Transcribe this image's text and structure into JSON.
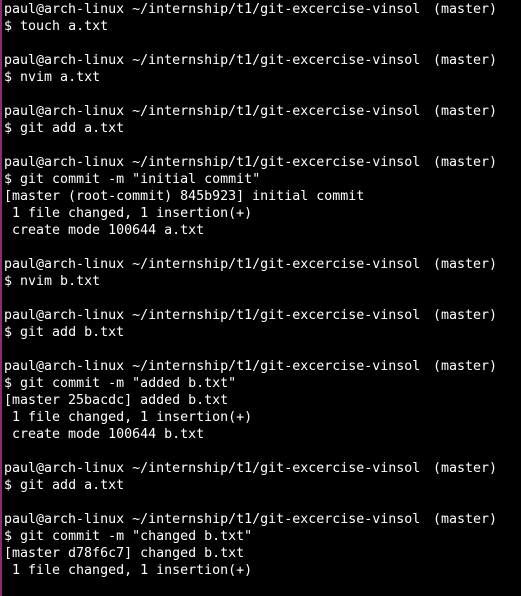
{
  "terminal": {
    "prompt": {
      "user_host_path": "paul@arch-linux ~/internship/t1/git-excercise-vinsol",
      "branch": "(master)",
      "symbol": "$"
    },
    "blocks": [
      {
        "command": "touch a.txt",
        "output": []
      },
      {
        "command": "nvim a.txt",
        "output": []
      },
      {
        "command": "git add a.txt",
        "output": []
      },
      {
        "command": "git commit -m \"initial commit\"",
        "output": [
          "[master (root-commit) 845b923] initial commit",
          " 1 file changed, 1 insertion(+)",
          " create mode 100644 a.txt"
        ]
      },
      {
        "command": "nvim b.txt",
        "output": []
      },
      {
        "command": "git add b.txt",
        "output": []
      },
      {
        "command": "git commit -m \"added b.txt\"",
        "output": [
          "[master 25bacdc] added b.txt",
          " 1 file changed, 1 insertion(+)",
          " create mode 100644 b.txt"
        ]
      },
      {
        "command": "git add a.txt",
        "output": []
      },
      {
        "command": "git commit -m \"changed b.txt\"",
        "output": [
          "[master d78f6c7] changed b.txt",
          " 1 file changed, 1 insertion(+)"
        ]
      }
    ]
  }
}
